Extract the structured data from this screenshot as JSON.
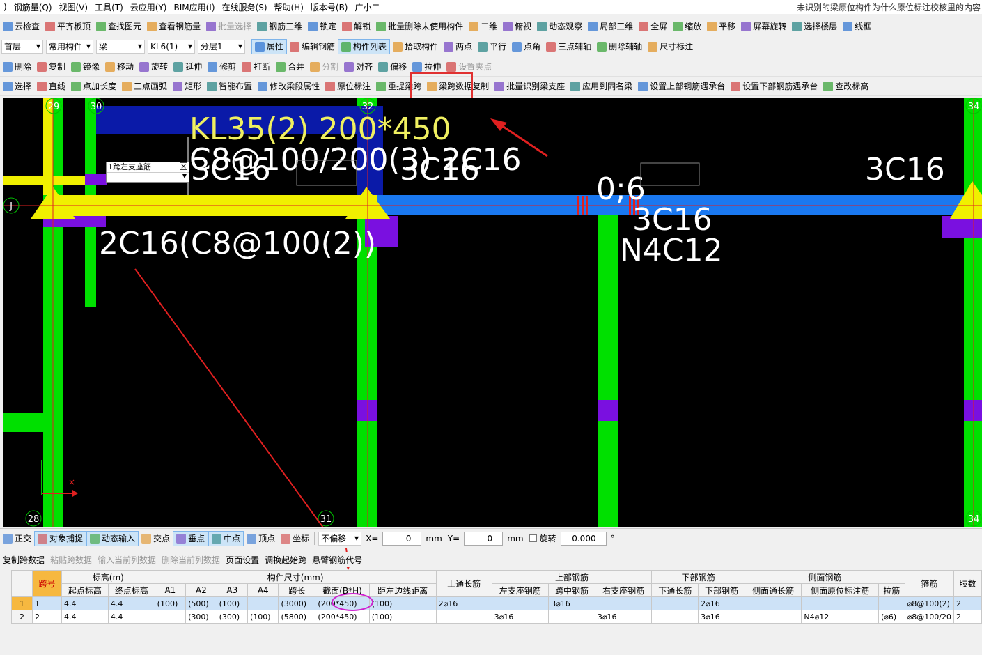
{
  "menubar": {
    "items": [
      ")",
      "钢筋量(Q)",
      "视图(V)",
      "工具(T)",
      "云应用(Y)",
      "BIM应用(I)",
      "在线服务(S)",
      "帮助(H)",
      "版本号(B)",
      "广小二"
    ],
    "notice": "未识别的梁原位构件为什么原位标注校核里的内容"
  },
  "toolbar1": [
    "云检查",
    "平齐板顶",
    "查找图元",
    "查看钢筋量",
    "批量选择",
    "钢筋三维",
    "锁定",
    "解锁",
    "批量删除未使用构件",
    "二维",
    "俯视",
    "动态观察",
    "局部三维",
    "全屏",
    "缩放",
    "平移",
    "屏幕旋转",
    "选择楼层",
    "线框"
  ],
  "toolbar2": {
    "floor": "首层",
    "category": "常用构件",
    "type": "梁",
    "component": "KL6(1)",
    "layer": "分层1",
    "buttons": [
      "属性",
      "编辑钢筋",
      "构件列表",
      "拾取构件",
      "两点",
      "平行",
      "点角",
      "三点辅轴",
      "删除辅轴",
      "尺寸标注"
    ]
  },
  "toolbar3": [
    "删除",
    "复制",
    "镜像",
    "移动",
    "旋转",
    "延伸",
    "修剪",
    "打断",
    "合并",
    "分割",
    "对齐",
    "偏移",
    "拉伸",
    "设置夹点"
  ],
  "toolbar4": [
    "选择",
    "直线",
    "点加长度",
    "三点画弧",
    "矩形",
    "智能布置",
    "修改梁段属性",
    "原位标注",
    "重提梁跨",
    "梁跨数据复制",
    "批量识别梁支座",
    "应用到同名梁",
    "设置上部钢筋遇承台",
    "设置下部钢筋遇承台",
    "查改标高"
  ],
  "canvas": {
    "axes": [
      "29",
      "30",
      "32",
      "34",
      "28",
      "31",
      "34",
      "J"
    ],
    "beam_label": "KL35(2) 200*450",
    "stirrup_label": "C8@100/200(3) 2C16",
    "top_left": "3C16",
    "top_mid": "3C16",
    "top_right": "3C16",
    "offset": "0;6",
    "bottom_mid": "3C16",
    "side": "N4C12",
    "bottom_left": "2C16(C8@100(2))",
    "popup_label": "1跨左支座筋"
  },
  "statusbar": {
    "items": [
      "正交",
      "对象捕捉",
      "动态输入",
      "交点",
      "垂点",
      "中点",
      "顶点",
      "坐标"
    ],
    "offset_mode": "不偏移",
    "x_label": "X=",
    "x_value": "0",
    "y_label": "Y=",
    "y_value": "0",
    "unit": "mm",
    "rotate_label": "旋转",
    "rotate_value": "0.000",
    "deg": "°"
  },
  "tablebar": [
    "复制跨数据",
    "粘贴跨数据",
    "输入当前列数据",
    "删除当前列数据",
    "页面设置",
    "调换起始跨",
    "悬臂钢筋代号"
  ],
  "table": {
    "groups": [
      "跨号",
      "标高(m)",
      "构件尺寸(mm)",
      "上通长筋",
      "上部钢筋",
      "下部钢筋",
      "侧面钢筋",
      "箍筋",
      "肢数"
    ],
    "subheaders": [
      "起点标高",
      "终点标高",
      "A1",
      "A2",
      "A3",
      "A4",
      "跨长",
      "截面(B*H)",
      "距左边线距离",
      "左支座钢筋",
      "跨中钢筋",
      "右支座钢筋",
      "下通长筋",
      "下部钢筋",
      "侧面通长筋",
      "侧面原位标注筋",
      "拉筋"
    ],
    "rows": [
      [
        "1",
        "1",
        "4.4",
        "4.4",
        "(100)",
        "(500)",
        "(100)",
        "",
        "(3000)",
        "(200*450)",
        "(100)",
        "2⌀16",
        "",
        "3⌀16",
        "",
        "",
        "2⌀16",
        "",
        "",
        "",
        "⌀8@100(2)",
        "2"
      ],
      [
        "2",
        "2",
        "4.4",
        "4.4",
        "",
        "(300)",
        "(300)",
        "(100)",
        "(5800)",
        "(200*450)",
        "(100)",
        "",
        "3⌀16",
        "",
        "3⌀16",
        "",
        "3⌀16",
        "",
        "N4⌀12",
        "(⌀6)",
        "⌀8@100/20",
        "2"
      ]
    ]
  }
}
